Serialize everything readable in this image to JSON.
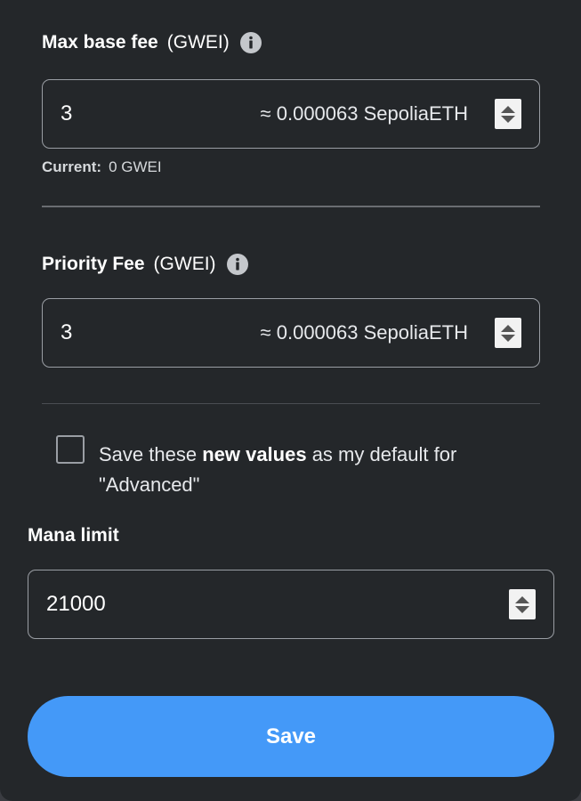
{
  "max_base_fee": {
    "label": "Max base fee",
    "unit": "(GWEI)",
    "info_icon": "info-circle-icon",
    "value": "3",
    "conversion": "≈ 0.000063 SepoliaETH",
    "current_label": "Current:",
    "current_value": "0 GWEI"
  },
  "priority_fee": {
    "label": "Priority Fee",
    "unit": "(GWEI)",
    "info_icon": "info-circle-icon",
    "value": "3",
    "conversion": "≈ 0.000063 SepoliaETH"
  },
  "save_default": {
    "checked": false,
    "text_before": "Save these ",
    "text_bold": "new values",
    "text_after": " as my default for \"Advanced\""
  },
  "mana_limit": {
    "label": "Mana limit",
    "value": "21000"
  },
  "save_button": {
    "label": "Save"
  },
  "colors": {
    "background": "#24272a",
    "primary_button": "#4499f8",
    "border": "#9a9ea4"
  }
}
